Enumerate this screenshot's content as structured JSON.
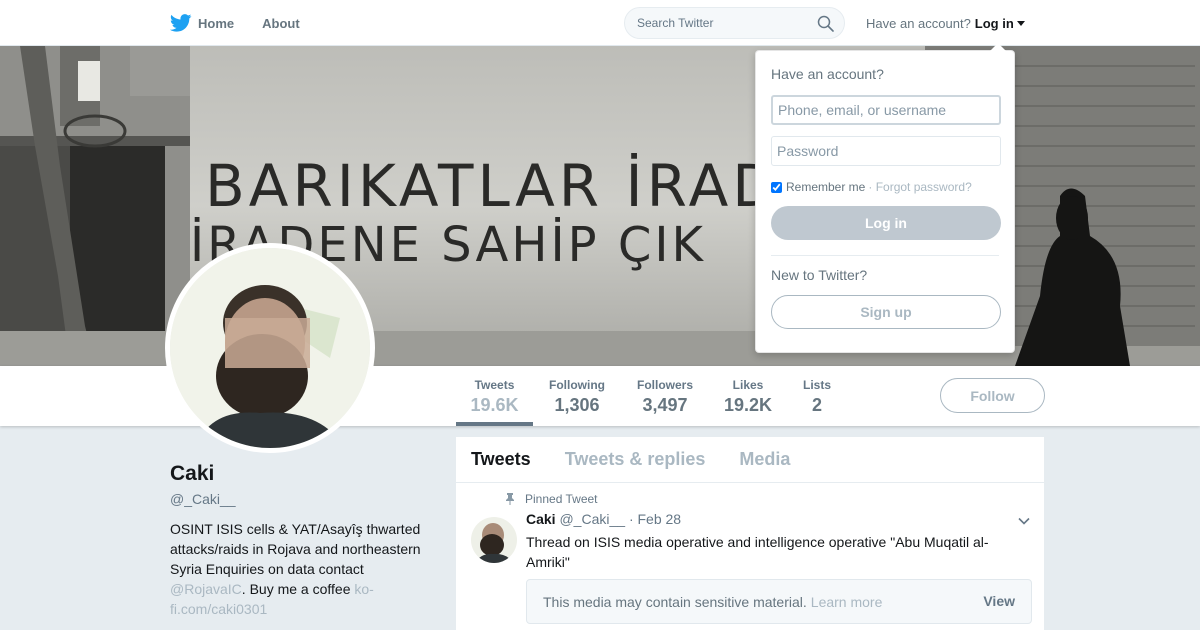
{
  "nav": {
    "home_label": "Home",
    "about_label": "About",
    "search_placeholder": "Search Twitter",
    "account_prompt": "Have an account?",
    "login_label": "Log in"
  },
  "banner": {
    "graffiti_line1": "BARIKATLAR İRAD",
    "graffiti_line2": "İRADENE SAHİP ÇIK"
  },
  "stats": [
    {
      "label": "Tweets",
      "value": "19.6K"
    },
    {
      "label": "Following",
      "value": "1,306"
    },
    {
      "label": "Followers",
      "value": "3,497"
    },
    {
      "label": "Likes",
      "value": "19.2K"
    },
    {
      "label": "Lists",
      "value": "2"
    }
  ],
  "follow_label": "Follow",
  "profile": {
    "name": "Caki",
    "handle": "@_Caki__",
    "bio_text": "OSINT ISIS cells & YAT/Asayîş thwarted attacks/raids in Rojava and northeastern Syria Enquiries on data contact ",
    "bio_mention": "@RojavaIC",
    "bio_mid": ". Buy me a coffee ",
    "bio_link": "ko-fi.com/caki0301"
  },
  "timeline": {
    "tabs": [
      "Tweets",
      "Tweets & replies",
      "Media"
    ],
    "pinned_label": "Pinned Tweet",
    "tweet": {
      "name": "Caki",
      "handle": "@_Caki__",
      "date": "· Feb 28",
      "text": "Thread on ISIS media operative and intelligence operative \"Abu Muqatil al-Amriki\""
    },
    "sensitive": {
      "message": "This media may contain sensitive material.",
      "learn_more": "Learn more",
      "view_label": "View"
    }
  },
  "login_dropdown": {
    "title": "Have an account?",
    "user_placeholder": "Phone, email, or username",
    "password_placeholder": "Password",
    "remember_label": "Remember me",
    "forgot_label": "· Forgot password?",
    "login_button": "Log in",
    "new_prompt": "New to Twitter?",
    "signup_button": "Sign up"
  },
  "colors": {
    "brand": "#1da1f2",
    "muted_text": "#657786",
    "disabled": "#aab8c2",
    "page_bg": "#e6ecf0"
  },
  "icons": [
    "twitter-bird-icon",
    "search-icon",
    "caret-down-icon",
    "pin-icon",
    "chevron-down-icon"
  ]
}
